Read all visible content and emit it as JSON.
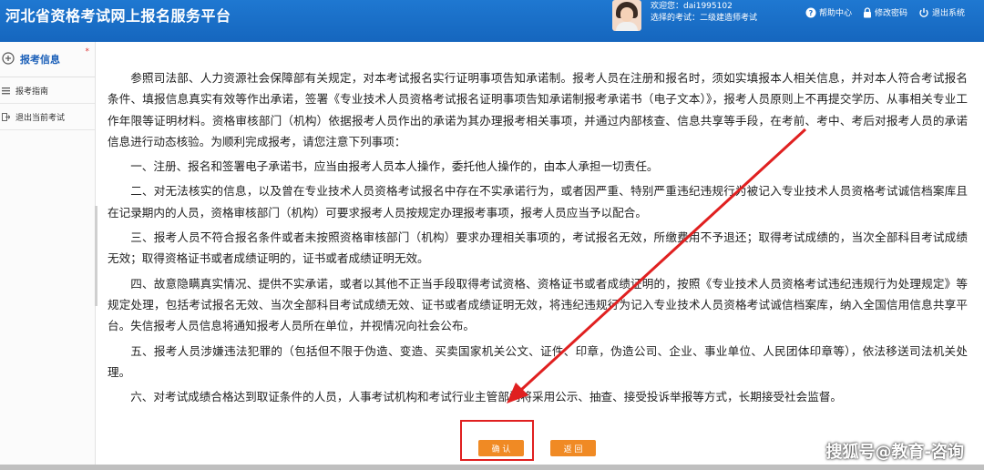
{
  "header": {
    "title": "河北省资格考试网上报名服务平台",
    "welcome": "欢迎您：dai1995102",
    "selected_exam": "选择的考试：二级建造师考试",
    "links": [
      {
        "label": "帮助中心",
        "icon": "question-circle-icon"
      },
      {
        "label": "修改密码",
        "icon": "lock-icon"
      },
      {
        "label": "退出系统",
        "icon": "power-icon"
      }
    ]
  },
  "sidebar": {
    "head": {
      "label": "报考信息",
      "icon": "plus-circle-icon",
      "marker": "*"
    },
    "items": [
      {
        "label": "报考指南",
        "icon": "list-icon"
      },
      {
        "label": "退出当前考试",
        "icon": "exit-icon"
      }
    ]
  },
  "content": {
    "paragraphs": [
      "参照司法部、人力资源社会保障部有关规定，对本考试报名实行证明事项告知承诺制。报考人员在注册和报名时，须如实填报本人相关信息，并对本人符合考试报名条件、填报信息真实有效等作出承诺，签署《专业技术人员资格考试报名证明事项告知承诺制报考承诺书（电子文本）》，报考人员原则上不再提交学历、从事相关专业工作年限等证明材料。资格审核部门（机构）依据报考人员作出的承诺为其办理报考相关事项，并通过内部核查、信息共享等手段，在考前、考中、考后对报考人员的承诺信息进行动态核验。为顺利完成报考，请您注意下列事项：",
      "一、注册、报名和签署电子承诺书，应当由报考人员本人操作，委托他人操作的，由本人承担一切责任。",
      "二、对无法核实的信息，以及曾在专业技术人员资格考试报名中存在不实承诺行为，或者因严重、特别严重违纪违规行为被记入专业技术人员资格考试诚信档案库且在记录期内的人员，资格审核部门（机构）可要求报考人员按规定办理报考事项，报考人员应当予以配合。",
      "三、报考人员不符合报名条件或者未按照资格审核部门（机构）要求办理相关事项的，考试报名无效，所缴费用不予退还；取得考试成绩的，当次全部科目考试成绩无效；取得资格证书或者成绩证明的，证书或者成绩证明无效。",
      "四、故意隐瞒真实情况、提供不实承诺，或者以其他不正当手段取得考试资格、资格证书或者成绩证明的，按照《专业技术人员资格考试违纪违规行为处理规定》等规定处理，包括考试报名无效、当次全部科目考试成绩无效、证书或者成绩证明无效，将违纪违规行为记入专业技术人员资格考试诚信档案库，纳入全国信用信息共享平台。失信报考人员信息将通知报考人员所在单位，并视情况向社会公布。",
      "五、报考人员涉嫌违法犯罪的（包括但不限于伪造、变造、买卖国家机关公文、证件、印章，伪造公司、企业、事业单位、人民团体印章等），依法移送司法机关处理。",
      "六、对考试成绩合格达到取证条件的人员，人事考试机构和考试行业主管部门将采用公示、抽查、接受投诉举报等方式，长期接受社会监督。"
    ]
  },
  "buttons": {
    "confirm": "确 认",
    "back": "返 回"
  },
  "watermark": "搜狐号@教育-咨询",
  "colors": {
    "header": "#1a6fc9",
    "button": "#f08a24",
    "annotation": "#e02020"
  }
}
